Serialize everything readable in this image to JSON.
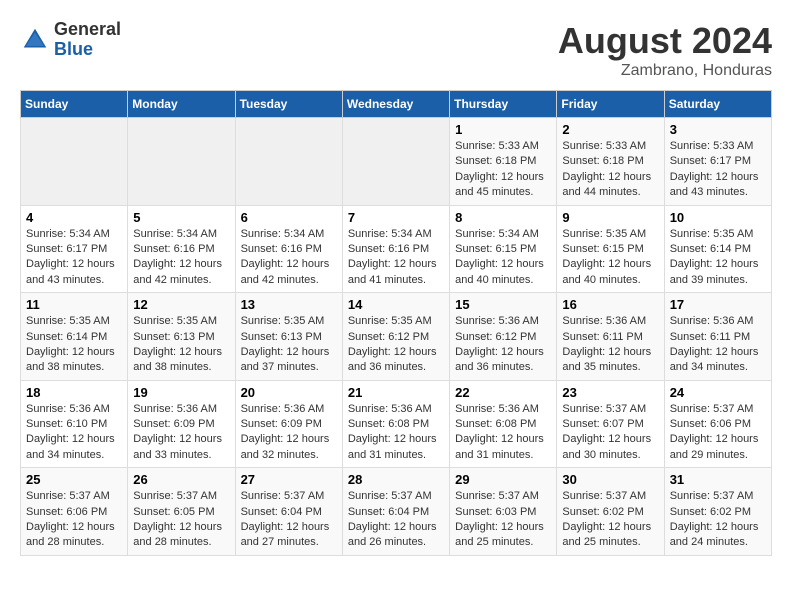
{
  "logo": {
    "general": "General",
    "blue": "Blue"
  },
  "header": {
    "title": "August 2024",
    "subtitle": "Zambrano, Honduras"
  },
  "weekdays": [
    "Sunday",
    "Monday",
    "Tuesday",
    "Wednesday",
    "Thursday",
    "Friday",
    "Saturday"
  ],
  "weeks": [
    [
      {
        "day": "",
        "info": ""
      },
      {
        "day": "",
        "info": ""
      },
      {
        "day": "",
        "info": ""
      },
      {
        "day": "",
        "info": ""
      },
      {
        "day": "1",
        "info": "Sunrise: 5:33 AM\nSunset: 6:18 PM\nDaylight: 12 hours\nand 45 minutes."
      },
      {
        "day": "2",
        "info": "Sunrise: 5:33 AM\nSunset: 6:18 PM\nDaylight: 12 hours\nand 44 minutes."
      },
      {
        "day": "3",
        "info": "Sunrise: 5:33 AM\nSunset: 6:17 PM\nDaylight: 12 hours\nand 43 minutes."
      }
    ],
    [
      {
        "day": "4",
        "info": "Sunrise: 5:34 AM\nSunset: 6:17 PM\nDaylight: 12 hours\nand 43 minutes."
      },
      {
        "day": "5",
        "info": "Sunrise: 5:34 AM\nSunset: 6:16 PM\nDaylight: 12 hours\nand 42 minutes."
      },
      {
        "day": "6",
        "info": "Sunrise: 5:34 AM\nSunset: 6:16 PM\nDaylight: 12 hours\nand 42 minutes."
      },
      {
        "day": "7",
        "info": "Sunrise: 5:34 AM\nSunset: 6:16 PM\nDaylight: 12 hours\nand 41 minutes."
      },
      {
        "day": "8",
        "info": "Sunrise: 5:34 AM\nSunset: 6:15 PM\nDaylight: 12 hours\nand 40 minutes."
      },
      {
        "day": "9",
        "info": "Sunrise: 5:35 AM\nSunset: 6:15 PM\nDaylight: 12 hours\nand 40 minutes."
      },
      {
        "day": "10",
        "info": "Sunrise: 5:35 AM\nSunset: 6:14 PM\nDaylight: 12 hours\nand 39 minutes."
      }
    ],
    [
      {
        "day": "11",
        "info": "Sunrise: 5:35 AM\nSunset: 6:14 PM\nDaylight: 12 hours\nand 38 minutes."
      },
      {
        "day": "12",
        "info": "Sunrise: 5:35 AM\nSunset: 6:13 PM\nDaylight: 12 hours\nand 38 minutes."
      },
      {
        "day": "13",
        "info": "Sunrise: 5:35 AM\nSunset: 6:13 PM\nDaylight: 12 hours\nand 37 minutes."
      },
      {
        "day": "14",
        "info": "Sunrise: 5:35 AM\nSunset: 6:12 PM\nDaylight: 12 hours\nand 36 minutes."
      },
      {
        "day": "15",
        "info": "Sunrise: 5:36 AM\nSunset: 6:12 PM\nDaylight: 12 hours\nand 36 minutes."
      },
      {
        "day": "16",
        "info": "Sunrise: 5:36 AM\nSunset: 6:11 PM\nDaylight: 12 hours\nand 35 minutes."
      },
      {
        "day": "17",
        "info": "Sunrise: 5:36 AM\nSunset: 6:11 PM\nDaylight: 12 hours\nand 34 minutes."
      }
    ],
    [
      {
        "day": "18",
        "info": "Sunrise: 5:36 AM\nSunset: 6:10 PM\nDaylight: 12 hours\nand 34 minutes."
      },
      {
        "day": "19",
        "info": "Sunrise: 5:36 AM\nSunset: 6:09 PM\nDaylight: 12 hours\nand 33 minutes."
      },
      {
        "day": "20",
        "info": "Sunrise: 5:36 AM\nSunset: 6:09 PM\nDaylight: 12 hours\nand 32 minutes."
      },
      {
        "day": "21",
        "info": "Sunrise: 5:36 AM\nSunset: 6:08 PM\nDaylight: 12 hours\nand 31 minutes."
      },
      {
        "day": "22",
        "info": "Sunrise: 5:36 AM\nSunset: 6:08 PM\nDaylight: 12 hours\nand 31 minutes."
      },
      {
        "day": "23",
        "info": "Sunrise: 5:37 AM\nSunset: 6:07 PM\nDaylight: 12 hours\nand 30 minutes."
      },
      {
        "day": "24",
        "info": "Sunrise: 5:37 AM\nSunset: 6:06 PM\nDaylight: 12 hours\nand 29 minutes."
      }
    ],
    [
      {
        "day": "25",
        "info": "Sunrise: 5:37 AM\nSunset: 6:06 PM\nDaylight: 12 hours\nand 28 minutes."
      },
      {
        "day": "26",
        "info": "Sunrise: 5:37 AM\nSunset: 6:05 PM\nDaylight: 12 hours\nand 28 minutes."
      },
      {
        "day": "27",
        "info": "Sunrise: 5:37 AM\nSunset: 6:04 PM\nDaylight: 12 hours\nand 27 minutes."
      },
      {
        "day": "28",
        "info": "Sunrise: 5:37 AM\nSunset: 6:04 PM\nDaylight: 12 hours\nand 26 minutes."
      },
      {
        "day": "29",
        "info": "Sunrise: 5:37 AM\nSunset: 6:03 PM\nDaylight: 12 hours\nand 25 minutes."
      },
      {
        "day": "30",
        "info": "Sunrise: 5:37 AM\nSunset: 6:02 PM\nDaylight: 12 hours\nand 25 minutes."
      },
      {
        "day": "31",
        "info": "Sunrise: 5:37 AM\nSunset: 6:02 PM\nDaylight: 12 hours\nand 24 minutes."
      }
    ]
  ]
}
